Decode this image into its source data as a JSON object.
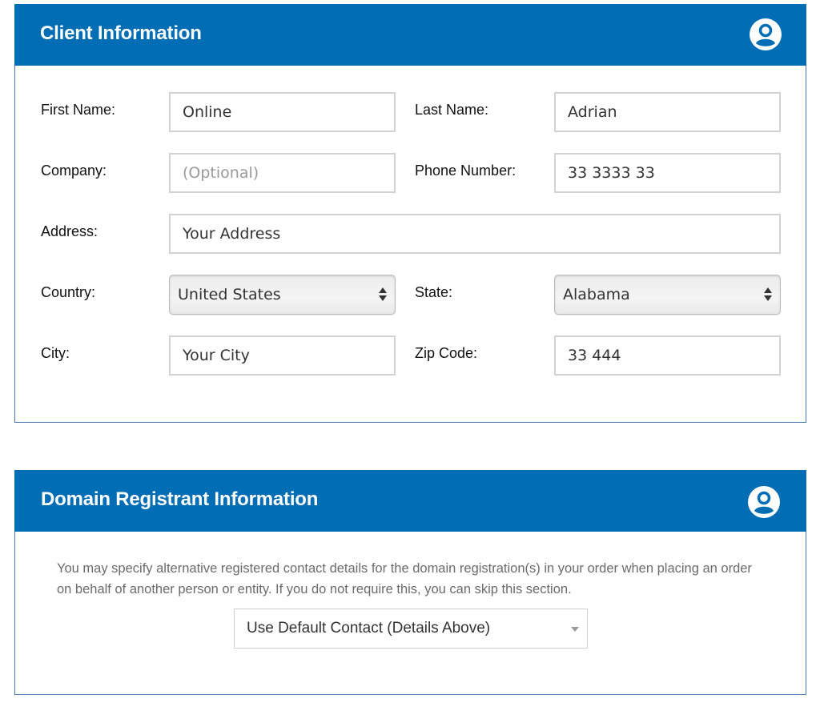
{
  "colors": {
    "header_bg": "#016db5",
    "panel_border": "#4a7bb0",
    "header_text": "#ffffff"
  },
  "client": {
    "title": "Client Information",
    "icon": "user-circle-icon",
    "fields": {
      "first_name": {
        "label": "First Name:",
        "value": "Online"
      },
      "last_name": {
        "label": "Last Name:",
        "value": "Adrian"
      },
      "company": {
        "label": "Company:",
        "value": "",
        "placeholder": "(Optional)"
      },
      "phone": {
        "label": "Phone Number:",
        "value": "33 3333 33"
      },
      "address": {
        "label": "Address:",
        "value": "Your Address"
      },
      "country": {
        "label": "Country:",
        "selected": "United States"
      },
      "state": {
        "label": "State:",
        "selected": "Alabama"
      },
      "city": {
        "label": "City:",
        "value": "Your City"
      },
      "zip": {
        "label": "Zip Code:",
        "value": "33 444"
      }
    }
  },
  "registrant": {
    "title": "Domain Registrant Information",
    "icon": "user-circle-icon",
    "description": "You may specify alternative registered contact details for the domain registration(s) in your order when placing an order on behalf of another person or entity. If you do not require this, you can skip this section.",
    "contact_select": {
      "selected": "Use Default Contact (Details Above)"
    }
  }
}
